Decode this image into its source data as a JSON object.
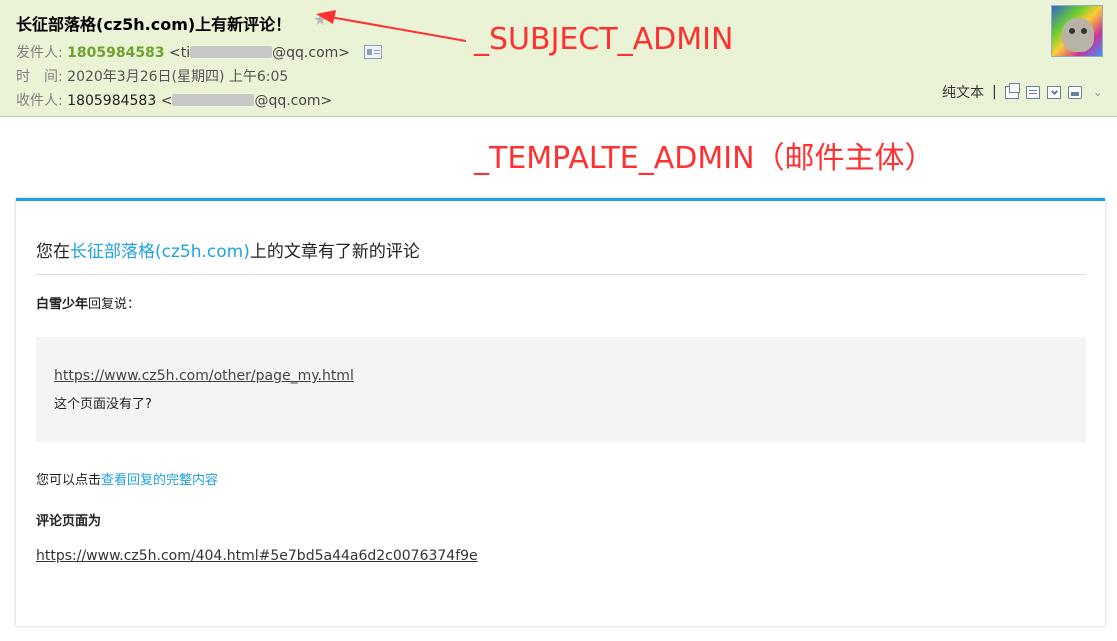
{
  "header": {
    "subject": "长征部落格(cz5h.com)上有新评论！",
    "sender_label": "发件人:",
    "sender_name": "1805984583",
    "sender_addr_prefix": "<ti",
    "sender_addr_suffix": "@qq.com>",
    "time_label": "时　间:",
    "time_value": "2020年3月26日(星期四) 上午6:05",
    "recipient_label": "收件人:",
    "recipient_name": "1805984583",
    "recipient_addr_prefix": "<",
    "recipient_addr_suffix": "@qq.com>"
  },
  "toolbar": {
    "plain_text": "纯文本",
    "separator": "|",
    "icons": [
      "new-window-icon",
      "note-icon",
      "download-icon",
      "print-icon"
    ],
    "more_icon": "chevron-down-icon"
  },
  "annotations": {
    "subject": "_SUBJECT_ADMIN",
    "template": "_TEMPALTE_ADMIN（邮件主体）",
    "color": "#ff3030"
  },
  "mail": {
    "title_prefix": "您在",
    "title_link": "长征部落格(cz5h.com)",
    "title_suffix": "上的文章有了新的评论",
    "replier_name": "白雪少年",
    "replier_suffix": "回复说：",
    "quote_link": "https://www.cz5h.com/other/page_my.html",
    "quote_text": "这个页面没有了?",
    "click_prefix": "您可以点击",
    "click_link": "查看回复的完整内容",
    "page_heading": "评论页面为",
    "page_link": "https://www.cz5h.com/404.html#5e7bd5a44a6d2c0076374f9e"
  },
  "colors": {
    "header_bg": "#ebf3d7",
    "accent": "#1fa3dc",
    "sender_green": "#6fa22f"
  }
}
